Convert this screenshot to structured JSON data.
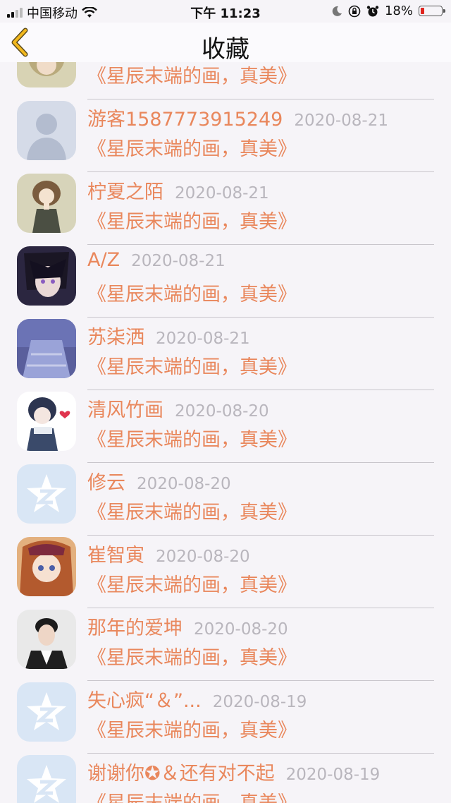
{
  "status_bar": {
    "carrier": "中国移动",
    "time": "下午 11:23",
    "battery_percent": "18%",
    "battery_level": 0.18,
    "icons": [
      "signal-icon",
      "wifi-icon",
      "moon-icon",
      "orientation-lock-icon",
      "alarm-icon",
      "battery-icon"
    ]
  },
  "nav": {
    "title": "收藏",
    "back_icon": "chevron-left-icon",
    "accent": "#f2b81d"
  },
  "colors": {
    "name": "#e9875c",
    "date": "#b9b6bd",
    "background": "#f6f4f8"
  },
  "favorites": [
    {
      "name": "",
      "date": "",
      "message": "《星辰末端的画，真美》",
      "avatar": "anime-avatar-partial"
    },
    {
      "name": "游客1587773915249",
      "date": "2020-08-21",
      "message": "《星辰末端的画，真美》",
      "avatar": "default-person-avatar"
    },
    {
      "name": "柠夏之陌",
      "date": "2020-08-21",
      "message": "《星辰末端的画，真美》",
      "avatar": "anime-girl-avatar"
    },
    {
      "name": "A/Z",
      "date": "2020-08-21",
      "message": "《星辰末端的画，真美》",
      "avatar": "anime-boy-avatar"
    },
    {
      "name": "苏柒洒",
      "date": "2020-08-21",
      "message": "《星辰末端的画，真美》",
      "avatar": "blue-dress-avatar"
    },
    {
      "name": "清风竹画",
      "date": "2020-08-20",
      "message": "《星辰末端的画，真美》",
      "avatar": "anime-heart-avatar"
    },
    {
      "name": "修云",
      "date": "2020-08-20",
      "message": "《星辰末端的画，真美》",
      "avatar": "qzone-star-avatar"
    },
    {
      "name": "崔智寅",
      "date": "2020-08-20",
      "message": "《星辰末端的画，真美》",
      "avatar": "anime-redhair-avatar"
    },
    {
      "name": "那年的爱坤",
      "date": "2020-08-20",
      "message": "《星辰末端的画，真美》",
      "avatar": "man-photo-avatar"
    },
    {
      "name": "失心疯“＆”...",
      "date": "2020-08-19",
      "message": "《星辰末端的画，真美》",
      "avatar": "qzone-star-avatar"
    },
    {
      "name": "谢谢你✪＆还有对不起",
      "date": "2020-08-19",
      "message": "《星辰末端的画，真美》",
      "avatar": "qzone-star-avatar"
    }
  ]
}
